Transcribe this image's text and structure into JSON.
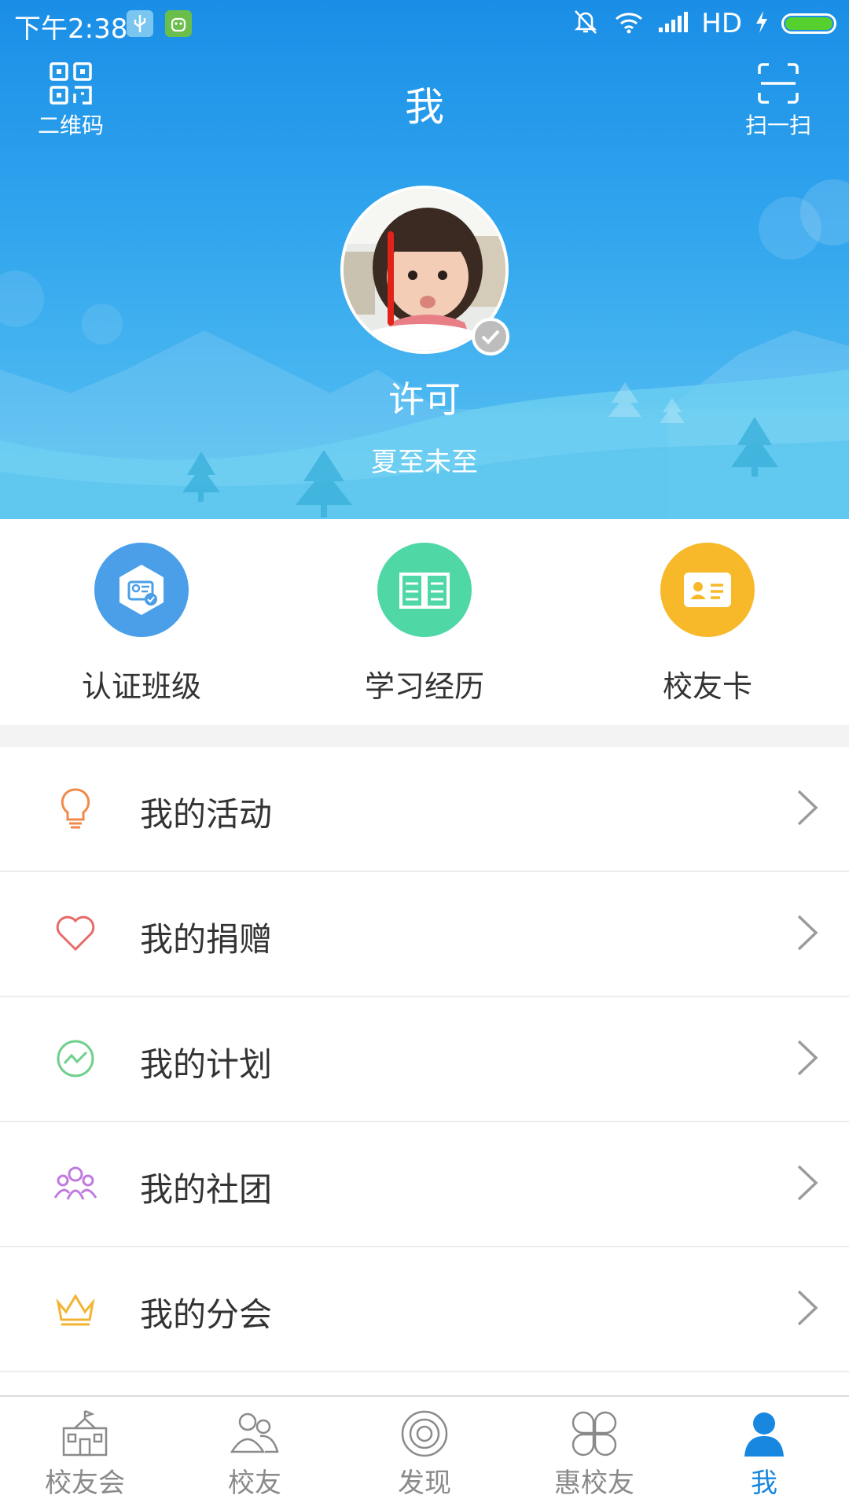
{
  "status_bar": {
    "time": "下午2:38",
    "network": "HD"
  },
  "header": {
    "title": "我",
    "qr_label": "二维码",
    "scan_label": "扫一扫"
  },
  "profile": {
    "name": "许可",
    "signature": "夏至未至",
    "verified": true
  },
  "quick_actions": [
    {
      "label": "认证班级",
      "icon": "certified-class-icon",
      "color": "#4a9fe8"
    },
    {
      "label": "学习经历",
      "icon": "open-book-icon",
      "color": "#4fd7a6"
    },
    {
      "label": "校友卡",
      "icon": "id-card-icon",
      "color": "#f7b82a"
    }
  ],
  "menu": [
    {
      "label": "我的活动",
      "icon": "lightbulb-icon",
      "color": "#f08a4b"
    },
    {
      "label": "我的捐赠",
      "icon": "heart-icon",
      "color": "#e86a6a"
    },
    {
      "label": "我的计划",
      "icon": "trend-icon",
      "color": "#6fd08c"
    },
    {
      "label": "我的社团",
      "icon": "group-icon",
      "color": "#c07ae0"
    },
    {
      "label": "我的分会",
      "icon": "crown-icon",
      "color": "#f2b430"
    }
  ],
  "tabs": [
    {
      "label": "校友会",
      "icon": "school-building-icon",
      "active": false
    },
    {
      "label": "校友",
      "icon": "people-icon",
      "active": false
    },
    {
      "label": "发现",
      "icon": "discover-icon",
      "active": false
    },
    {
      "label": "惠校友",
      "icon": "clover-icon",
      "active": false
    },
    {
      "label": "我",
      "icon": "person-icon",
      "active": true
    }
  ],
  "colors": {
    "brand_blue": "#1a8ee6",
    "active_tab": "#1787e0",
    "battery_green": "#56d02e"
  }
}
